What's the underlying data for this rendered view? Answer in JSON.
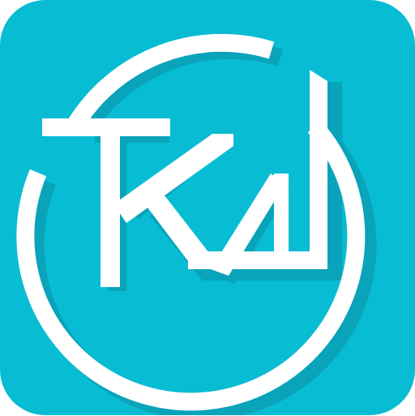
{
  "app_icon": {
    "logo_text": "TKN",
    "background_color": "#08bcd3",
    "mark_color": "#ffffff",
    "shadow_color": "#0a8fa6"
  }
}
